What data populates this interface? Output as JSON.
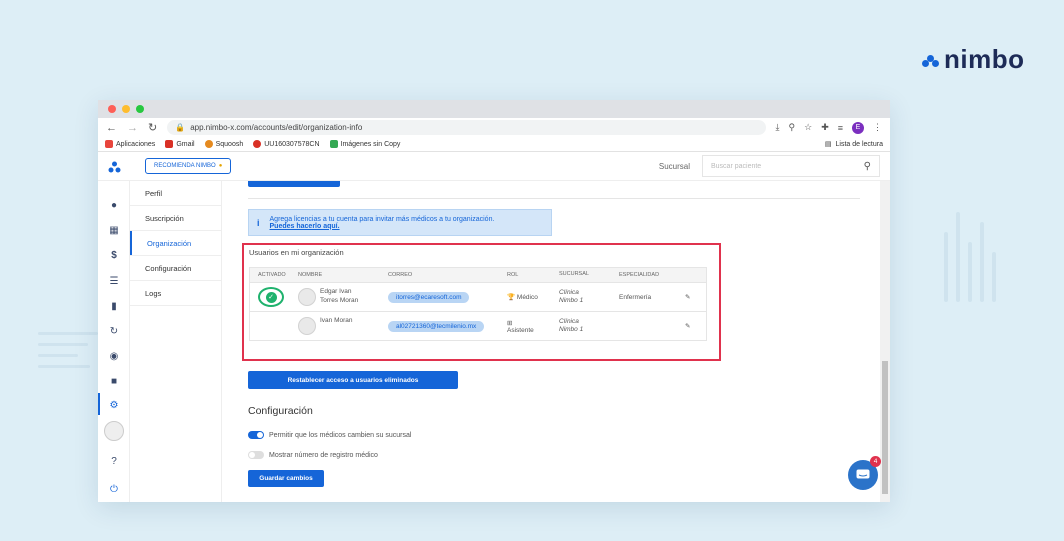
{
  "brand": {
    "name": "nimbo"
  },
  "browser": {
    "url": "app.nimbo-x.com/accounts/edit/organization-info",
    "profile_initial": "E",
    "bookmarks": [
      {
        "label": "Aplicaciones",
        "icon": "apps-grid-icon",
        "color": "#e8453c"
      },
      {
        "label": "Gmail",
        "icon": "gmail-icon",
        "color": "#d93025"
      },
      {
        "label": "Squoosh",
        "icon": "squoosh-icon",
        "color": "#e58a1f"
      },
      {
        "label": "UU160307578CN",
        "icon": "map-pin-icon",
        "color": "#d93025"
      },
      {
        "label": "Imágenes sin Copy",
        "icon": "image-icon",
        "color": "#34a853"
      }
    ],
    "reading_list": "Lista de lectura"
  },
  "appbar": {
    "recommend_label": "RECOMIENDA NIMBO",
    "sucursal_label": "Sucursal",
    "search_placeholder": "Buscar paciente"
  },
  "submenu": [
    {
      "label": "Perfil",
      "active": false
    },
    {
      "label": "Suscripción",
      "active": false
    },
    {
      "label": "Organización",
      "active": true
    },
    {
      "label": "Configuración",
      "active": false
    },
    {
      "label": "Logs",
      "active": false
    }
  ],
  "info_banner": {
    "text": "Agrega licencias a tu cuenta para invitar más médicos a tu organización.",
    "link": "Puedes hacerlo aquí."
  },
  "users": {
    "title": "Usuarios en mi organización",
    "columns": [
      "ACTIVADO",
      "NOMBRE",
      "CORREO",
      "ROL",
      "SUCURSAL",
      "ESPECIALIDAD"
    ],
    "rows": [
      {
        "name_line1": "Edgar Ivan",
        "name_line2": "Torres Moran",
        "email": "itorres@ecaresoft.com",
        "role": "Médico",
        "branch_line1": "Clínica",
        "branch_line2": "Nimbo 1",
        "specialty": "Enfermería",
        "activated": true
      },
      {
        "name_line1": "Ivan Moran",
        "name_line2": "",
        "email": "al02721360@tecmilenio.mx",
        "role": "Asistente",
        "branch_line1": "Clínica",
        "branch_line2": "Nimbo 1",
        "specialty": "",
        "activated": false
      }
    ]
  },
  "restore_button": "Restablecer acceso a usuarios eliminados",
  "config": {
    "title": "Configuración",
    "toggle1": {
      "label": "Permitir que los médicos cambien su sucursal",
      "on": true
    },
    "toggle2": {
      "label": "Mostrar número de registro médico",
      "on": false
    },
    "save_button": "Guardar cambios"
  },
  "chat": {
    "badge": "4"
  },
  "colors": {
    "accent": "#1565d8",
    "highlight": "#e0324d",
    "success": "#1fb26d"
  }
}
